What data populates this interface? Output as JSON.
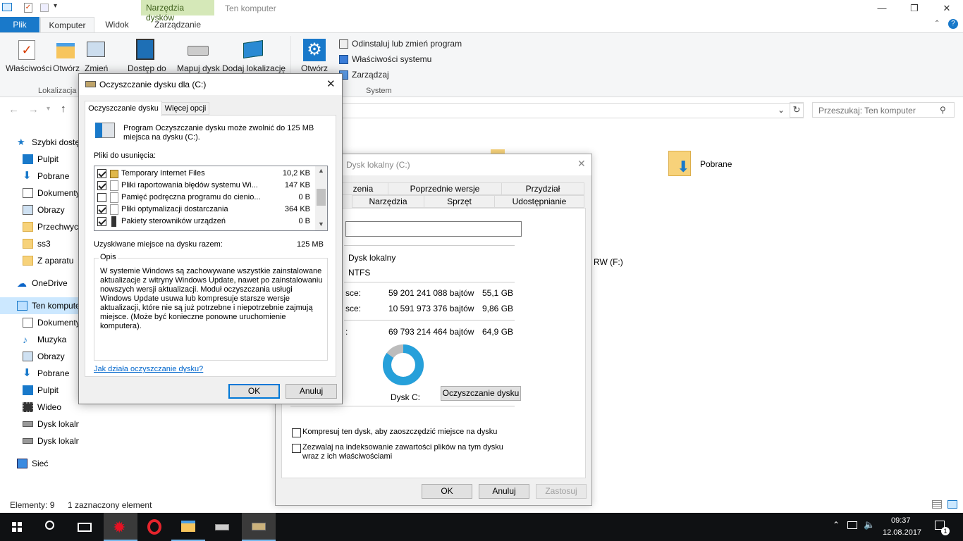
{
  "window": {
    "context_tab": "Narzędzia dysków",
    "title": "Ten komputer",
    "minimize": "—",
    "maximize": "❐",
    "close": "✕"
  },
  "ribbon": {
    "tabs": {
      "file": "Plik",
      "computer": "Komputer",
      "view": "Widok",
      "manage": "Zarządzanie"
    },
    "buttons": {
      "properties": "Właściwości",
      "open": "Otwórz",
      "rename": "Zmień",
      "access": "Dostęp do",
      "map_drive": "Mapuj dysk",
      "add_location": "Dodaj lokalizację",
      "open_settings": "Otwórz",
      "uninstall": "Odinstaluj lub zmień program",
      "system_props": "Właściwości systemu",
      "manage": "Zarządzaj"
    },
    "groups": {
      "location": "Lokalizacja",
      "system": "System"
    }
  },
  "search": {
    "placeholder": "Przeszukaj: Ten komputer"
  },
  "nav": {
    "quick_access": "Szybki dostęp",
    "items_quick": [
      "Pulpit",
      "Pobrane",
      "Dokumenty",
      "Obrazy",
      "Przechwyco",
      "ss3",
      "Z aparatu"
    ],
    "onedrive": "OneDrive",
    "this_pc": "Ten komputer",
    "items_pc": [
      "Dokumenty",
      "Muzyka",
      "Obrazy",
      "Pobrane",
      "Pulpit",
      "Wideo",
      "Dysk lokalny (C:)",
      "Dysk lokalny (E:)"
    ],
    "network": "Sieć"
  },
  "content": {
    "pobrane": "Pobrane",
    "drive_f": "RW (F:)"
  },
  "status": {
    "items": "Elementy: 9",
    "selected": "1 zaznaczony element"
  },
  "taskbar": {
    "time": "09:37",
    "date": "12.08.2017",
    "notifications": "1"
  },
  "cleanup": {
    "title": "Oczyszczanie dysku dla  (C:)",
    "tab_main": "Oczyszczanie dysku",
    "tab_more": "Więcej opcji",
    "intro": "Program Oczyszczanie dysku może zwolnić do 125 MB miejsca na dysku  (C:).",
    "files_label": "Pliki do usunięcia:",
    "files": [
      {
        "name": "Temporary Internet Files",
        "size": "10,2 KB",
        "checked": true
      },
      {
        "name": "Pliki raportowania błędów systemu Wi...",
        "size": "147 KB",
        "checked": true
      },
      {
        "name": "Pamięć podręczna programu do cienio...",
        "size": "0 B",
        "checked": false
      },
      {
        "name": "Pliki optymalizacji dostarczania",
        "size": "364 KB",
        "checked": true
      },
      {
        "name": "Pakiety sterowników urządzeń",
        "size": "0 B",
        "checked": true
      }
    ],
    "total_label": "Uzyskiwane miejsce na dysku razem:",
    "total_value": "125 MB",
    "desc_label": "Opis",
    "description": "W systemie Windows są zachowywane wszystkie zainstalowane aktualizacje z witryny Windows Update, nawet po zainstalowaniu nowszych wersji aktualizacji. Moduł oczyszczania usługi Windows Update usuwa lub kompresuje starsze wersje aktualizacji, które nie są już potrzebne i niepotrzebnie zajmują miejsce. (Może być konieczne ponowne uruchomienie komputera).",
    "help_link": "Jak działa oczyszczanie dysku?",
    "ok": "OK",
    "cancel": "Anuluj"
  },
  "props": {
    "title": "Dysk lokalny (C:)",
    "tabs_row1": [
      "zenia",
      "Poprzednie wersje",
      "Przydział"
    ],
    "tabs_row2": [
      "Narzędzia",
      "Sprzęt",
      "Udostępnianie"
    ],
    "type_value": "Dysk lokalny",
    "fs_value": "NTFS",
    "used_label": "sce:",
    "used_bytes": "59 201 241 088 bajtów",
    "used_gb": "55,1 GB",
    "free_label": "sce:",
    "free_bytes": "10 591 973 376 bajtów",
    "free_gb": "9,86 GB",
    "cap_label": ":",
    "cap_bytes": "69 793 214 464 bajtów",
    "cap_gb": "64,9 GB",
    "used_fraction": 0.848,
    "disk_label": "Dysk C:",
    "cleanup_btn": "Oczyszczanie dysku",
    "compress": "Kompresuj ten dysk, aby zaoszczędzić miejsce na dysku",
    "index": "Zezwalaj na indeksowanie zawartości plików na tym dysku wraz z ich właściwościami",
    "ok": "OK",
    "cancel": "Anuluj",
    "apply": "Zastosuj"
  }
}
